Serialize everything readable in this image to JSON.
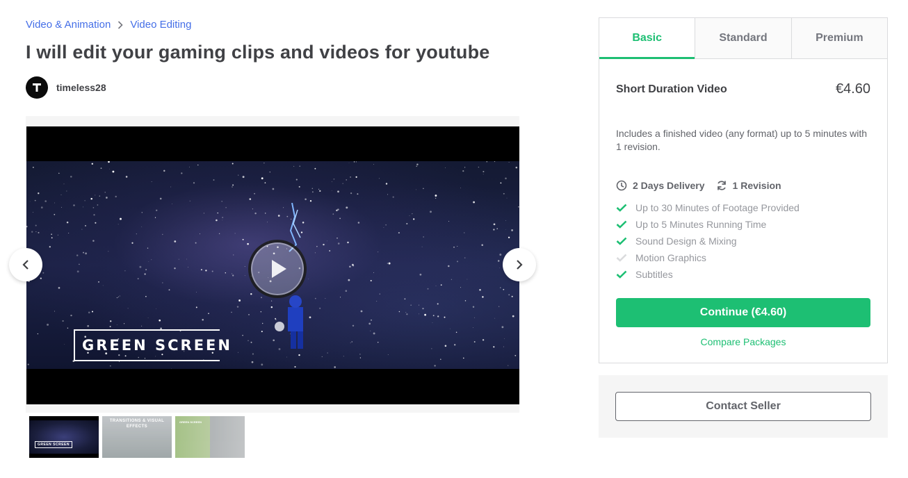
{
  "breadcrumb": {
    "category": "Video & Animation",
    "subcategory": "Video Editing",
    "separator_icon": "chevron-right-icon"
  },
  "gig": {
    "title": "I will edit your gaming clips and videos for youtube"
  },
  "seller": {
    "name": "timeless28",
    "avatar_letter": "T"
  },
  "gallery": {
    "overlay_text": "GREEN SCREEN",
    "thumbnails": [
      {
        "label": "GREEN SCREEN"
      },
      {
        "label": "TRANSITIONS & VISUAL EFFECTS"
      },
      {
        "label": "GREEN SCREEN"
      }
    ]
  },
  "packages": {
    "tabs": [
      "Basic",
      "Standard",
      "Premium"
    ],
    "active_tab": "Basic",
    "name": "Short Duration Video",
    "price": "€4.60",
    "description": "Includes a finished video (any format) up to 5 minutes with 1 revision.",
    "delivery": "2 Days Delivery",
    "revisions": "1 Revision",
    "features": [
      {
        "label": "Up to 30 Minutes of Footage Provided",
        "included": true
      },
      {
        "label": "Up to 5 Minutes Running Time",
        "included": true
      },
      {
        "label": "Sound Design & Mixing",
        "included": true
      },
      {
        "label": "Motion Graphics",
        "included": false
      },
      {
        "label": "Subtitles",
        "included": true
      }
    ],
    "continue_label": "Continue (€4.60)",
    "compare_label": "Compare Packages"
  },
  "contact": {
    "label": "Contact Seller"
  },
  "colors": {
    "accent_green": "#1dbf73",
    "link_blue": "#446ee7",
    "text_dark": "#404145",
    "text_muted": "#95979d"
  }
}
